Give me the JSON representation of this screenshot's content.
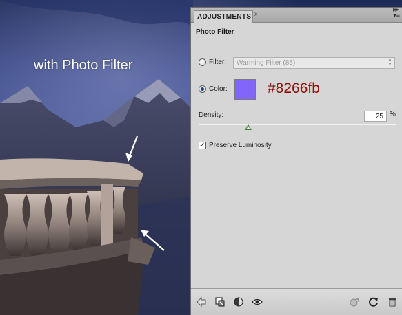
{
  "scene": {
    "caption": "with Photo Filter"
  },
  "panel": {
    "tab_label": "ADJUSTMENTS",
    "tab_close": "x",
    "collapse_glyph": "▸▸",
    "menu_glyph": "▾≡",
    "title": "Photo Filter",
    "filter": {
      "label": "Filter:",
      "value": "Warming Filter (85)",
      "selected": false
    },
    "color": {
      "label": "Color:",
      "selected": true,
      "swatch": "#8266fb",
      "hex_annotation": "#8266fb"
    },
    "density": {
      "label": "Density:",
      "value": "25",
      "unit": "%",
      "percent": 25
    },
    "preserve_luminosity": {
      "label": "Preserve Luminosity",
      "checked": true,
      "check_glyph": "✓"
    }
  },
  "bottom_icons": [
    "back-arrow-icon",
    "clip-layer-icon",
    "layer-visibility-circle-icon",
    "eye-icon",
    "previous-state-icon",
    "reset-icon",
    "trash-icon"
  ],
  "colors": {
    "panel_bg": "#d6d6d6",
    "annotation_red": "#8a0d0d",
    "slider_thumb": "#3d7d2e"
  }
}
